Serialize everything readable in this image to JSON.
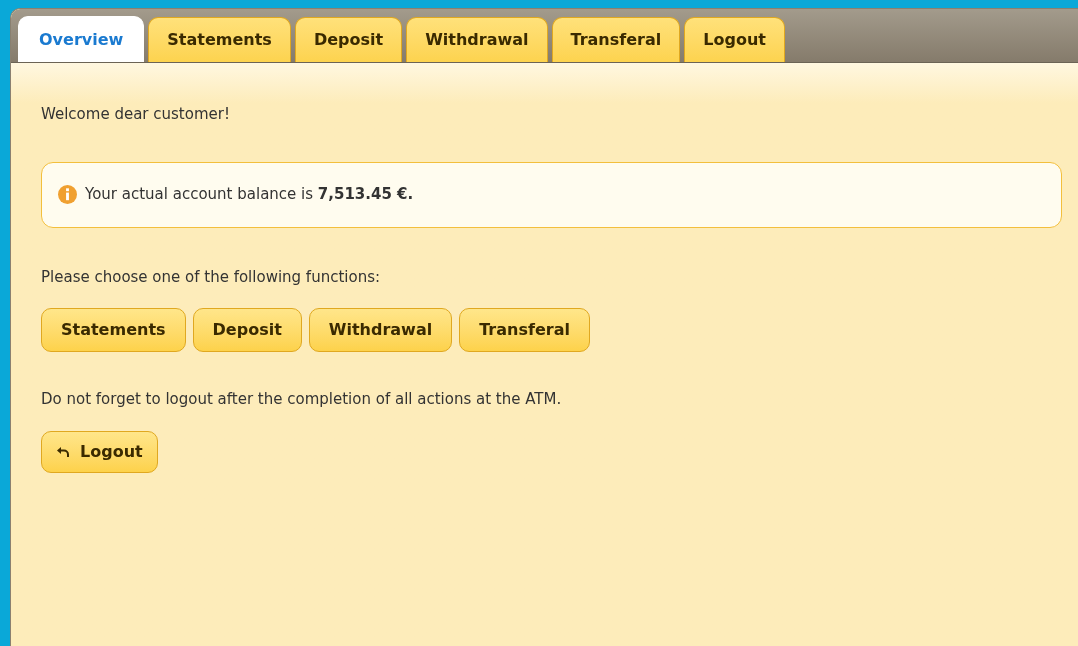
{
  "tabs": [
    {
      "label": "Overview",
      "selected": true
    },
    {
      "label": "Statements",
      "selected": false
    },
    {
      "label": "Deposit",
      "selected": false
    },
    {
      "label": "Withdrawal",
      "selected": false
    },
    {
      "label": "Transferal",
      "selected": false
    },
    {
      "label": "Logout",
      "selected": false
    }
  ],
  "welcome": "Welcome dear customer!",
  "notice": "Your actual account balance is **7,513.45 €.**",
  "prompt": "Please choose one of the following functions:",
  "function_buttons": [
    "Statements",
    "Deposit",
    "Withdrawal",
    "Transferal"
  ],
  "reminder": "Do not forget to logout after the completion of all actions at the ATM.",
  "logout_button": "Logout"
}
